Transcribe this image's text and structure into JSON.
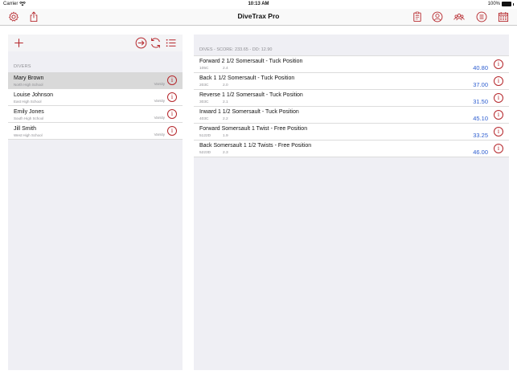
{
  "status_bar": {
    "carrier": "Carrier",
    "time": "10:13 AM",
    "battery": "100%"
  },
  "nav": {
    "title": "DiveTrax Pro",
    "left_icons": [
      "gear-icon",
      "share-icon"
    ],
    "right_icons": [
      "clipboard-icon",
      "person-icon",
      "group-icon",
      "list-circle-icon",
      "calendar-icon"
    ]
  },
  "left_panel": {
    "toolbar_icons": [
      "plus-icon",
      "arrow-circle-icon",
      "refresh-icon",
      "list-icon"
    ],
    "section_header": "DIVERS",
    "divers": [
      {
        "name": "Mary Brown",
        "school": "North High School",
        "level": "Varsity",
        "selected": true
      },
      {
        "name": "Louise Johnson",
        "school": "East High School",
        "level": "Varsity",
        "selected": false
      },
      {
        "name": "Emily Jones",
        "school": "South High School",
        "level": "Varsity",
        "selected": false
      },
      {
        "name": "Jill Smith",
        "school": "West High School",
        "level": "Varsity",
        "selected": false
      }
    ]
  },
  "right_panel": {
    "header": "DIVES - SCORE:  233.65 - DD: 12.90",
    "dives": [
      {
        "name": "Forward 2 1/2 Somersault - Tuck Position",
        "code": "105C",
        "dd": "2.4",
        "score": "40.80"
      },
      {
        "name": "Back 1 1/2 Somersault - Tuck Position",
        "code": "203C",
        "dd": "2.0",
        "score": "37.00"
      },
      {
        "name": "Reverse 1 1/2 Somersault - Tuck Position",
        "code": "303C",
        "dd": "2.1",
        "score": "31.50"
      },
      {
        "name": "Inward 1 1/2 Somersault - Tuck Position",
        "code": "403C",
        "dd": "2.2",
        "score": "45.10"
      },
      {
        "name": "Forward Somersault 1 Twist - Free Position",
        "code": "5122D",
        "dd": "1.9",
        "score": "33.25"
      },
      {
        "name": "Back Somersault 1 1/2 Twists - Free Position",
        "code": "5223D",
        "dd": "2.3",
        "score": "46.00"
      }
    ]
  },
  "colors": {
    "accent": "#b5262b",
    "score": "#2f5fd0",
    "panel_bg": "#efeff4"
  }
}
